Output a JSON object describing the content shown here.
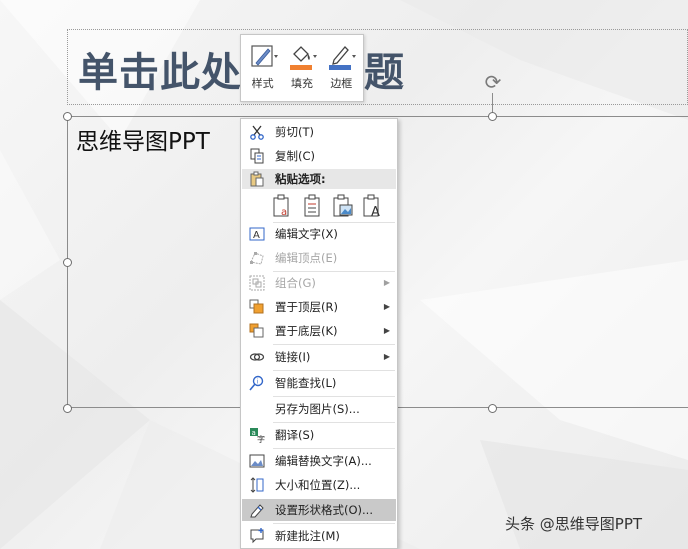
{
  "slide": {
    "title_partial": "单击此处",
    "title_tail": "题",
    "content_text": "思维导图PPT"
  },
  "mini_toolbar": {
    "style_label": "样式",
    "fill_label": "填充",
    "border_label": "边框",
    "fill_color": "#f08030",
    "border_color": "#4472c4"
  },
  "context_menu": {
    "cut": "剪切(T)",
    "copy": "复制(C)",
    "paste_options": "粘贴选项:",
    "edit_text": "编辑文字(X)",
    "edit_points": "编辑顶点(E)",
    "group": "组合(G)",
    "bring_to_front": "置于顶层(R)",
    "send_to_back": "置于底层(K)",
    "link": "链接(I)",
    "smart_lookup": "智能查找(L)",
    "save_as_picture": "另存为图片(S)...",
    "translate": "翻译(S)",
    "edit_alt_text": "编辑替换文字(A)...",
    "size_position": "大小和位置(Z)...",
    "format_shape": "设置形状格式(O)...",
    "new_comment": "新建批注(M)"
  },
  "watermark": "头条 @思维导图PPT"
}
